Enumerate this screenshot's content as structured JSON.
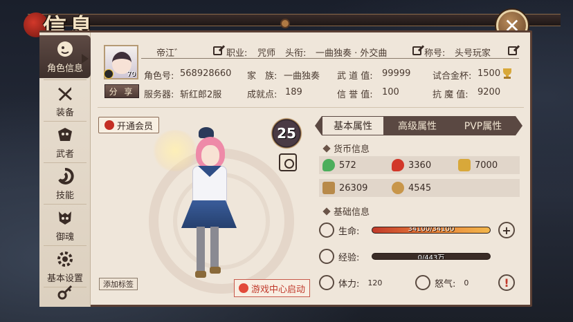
{
  "window": {
    "title": "信息"
  },
  "sidebar": {
    "items": [
      {
        "label": "角色信息",
        "icon": "character-icon"
      },
      {
        "label": "装备",
        "icon": "sword-icon"
      },
      {
        "label": "武者",
        "icon": "warrior-mask-icon"
      },
      {
        "label": "技能",
        "icon": "skill-swirl-icon"
      },
      {
        "label": "御魂",
        "icon": "soul-mask-icon"
      },
      {
        "label": "基本设置",
        "icon": "gear-icon"
      },
      {
        "label": "",
        "icon": "key-icon"
      }
    ]
  },
  "profile": {
    "avatar_level": "70",
    "name": "帝江゛",
    "profession_label": "职业:",
    "profession": "咒师",
    "title_label": "头衔:",
    "title": "一曲独奏 · 外交曲",
    "nickname_label": "称号:",
    "nickname": "头号玩家",
    "share_label": "分 享",
    "role_id_label": "角色号:",
    "role_id": "568928660",
    "family_label": "家　族:",
    "family": "一曲独奏",
    "martial_label": "武 道 值:",
    "martial": "99999",
    "cup_label": "试合金杯:",
    "cup": "1500",
    "server_label": "服务器:",
    "server": "斩红郎2服",
    "achievement_label": "成就点:",
    "achievement": "189",
    "honor_label": "信 誉 值:",
    "honor": "100",
    "resist_label": "抗 魔 值:",
    "resist": "9200"
  },
  "character_area": {
    "vip_button": "开通会员",
    "level": "25",
    "add_tag_button": "添加标签",
    "game_center_button": "游戏中心启动"
  },
  "tabs": [
    {
      "label": "基本属性",
      "active": true
    },
    {
      "label": "高级属性",
      "active": false
    },
    {
      "label": "PVP属性",
      "active": false
    }
  ],
  "currency": {
    "section_title": "货币信息",
    "items": [
      {
        "value": "572",
        "icon": "green-magatama-icon",
        "color": "#4cae5c"
      },
      {
        "value": "3360",
        "icon": "red-magatama-icon",
        "color": "#d2382a"
      },
      {
        "value": "7000",
        "icon": "gold-coin-icon",
        "color": "#d8a83a"
      },
      {
        "value": "26309",
        "icon": "gold-ingot-icon",
        "color": "#b88a4a"
      },
      {
        "value": "4545",
        "icon": "medal-coin-icon",
        "color": "#c8964a"
      }
    ]
  },
  "basic": {
    "section_title": "基础信息",
    "hp_label": "生命:",
    "hp_text": "34100/34100",
    "hp_fill": 1.0,
    "exp_label": "经验:",
    "exp_text": "0/443万",
    "exp_fill": 0.0,
    "stamina_label": "体力:",
    "stamina": "120",
    "rage_label": "怒气:",
    "rage": "0"
  },
  "colors": {
    "accent_dark": "#5a4842",
    "panel_bg": "#efe6da",
    "hp_bar": "#e0503a",
    "warning": "#c0392b"
  }
}
